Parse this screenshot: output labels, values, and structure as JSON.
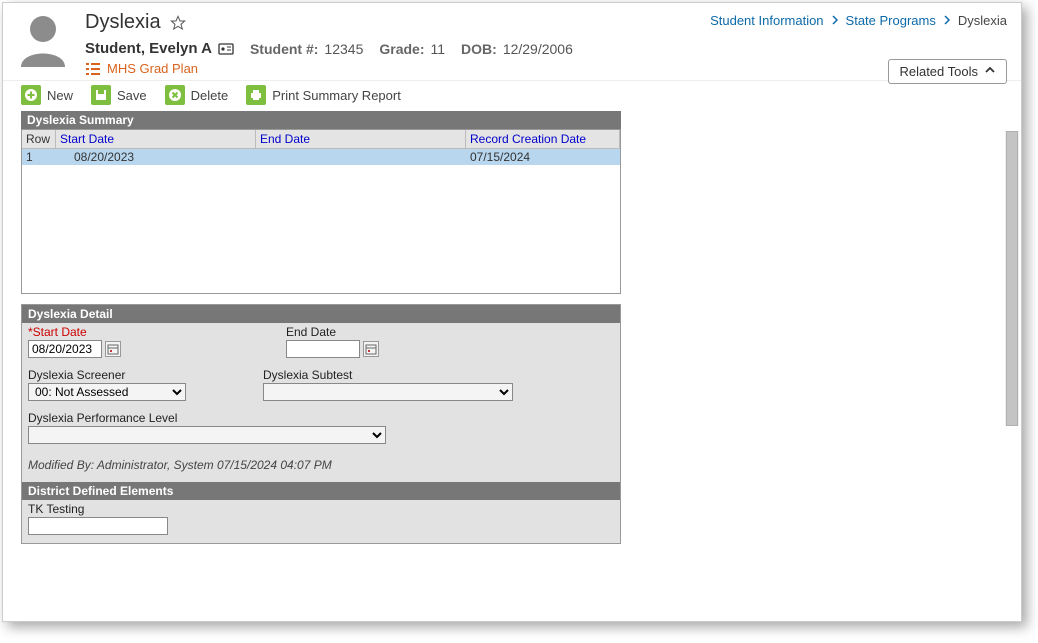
{
  "page": {
    "title": "Dyslexia"
  },
  "breadcrumb": {
    "items": [
      {
        "label": "Student Information"
      },
      {
        "label": "State Programs"
      }
    ],
    "current": "Dyslexia"
  },
  "student": {
    "name": "Student, Evelyn A",
    "number_label": "Student #:",
    "number": "12345",
    "grade_label": "Grade:",
    "grade": "11",
    "dob_label": "DOB:",
    "dob": "12/29/2006",
    "grad_plan": "MHS Grad Plan"
  },
  "related_tools": {
    "label": "Related Tools"
  },
  "toolbar": {
    "new_label": "New",
    "save_label": "Save",
    "delete_label": "Delete",
    "print_label": "Print Summary Report"
  },
  "summary": {
    "title": "Dyslexia Summary",
    "headers": {
      "row": "Row",
      "start": "Start Date",
      "end": "End Date",
      "created": "Record Creation Date"
    },
    "rows": [
      {
        "row": "1",
        "start": "08/20/2023",
        "end": "",
        "created": "07/15/2024"
      }
    ]
  },
  "detail": {
    "title": "Dyslexia Detail",
    "start_label": "*Start Date",
    "start_value": "08/20/2023",
    "end_label": "End Date",
    "end_value": "",
    "screener_label": "Dyslexia Screener",
    "screener_value": "00: Not Assessed",
    "subtest_label": "Dyslexia Subtest",
    "subtest_value": "",
    "perf_label": "Dyslexia Performance Level",
    "perf_value": "",
    "modified_by": "Modified By: Administrator, System 07/15/2024 04:07 PM"
  },
  "dde": {
    "title": "District Defined Elements",
    "field1_label": "TK Testing",
    "field1_value": ""
  }
}
